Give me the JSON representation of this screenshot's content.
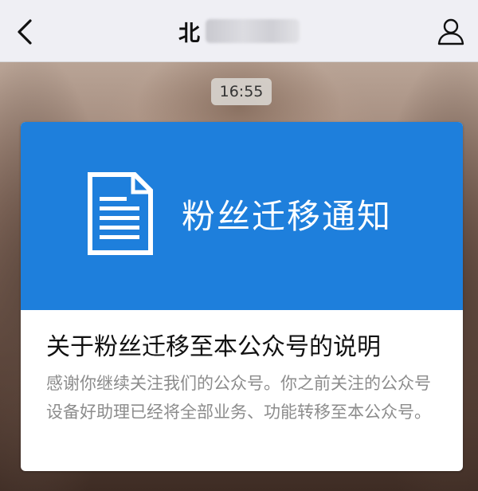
{
  "navbar": {
    "title": "北",
    "back_icon": "chevron-left-icon",
    "profile_icon": "person-icon"
  },
  "chat": {
    "timestamp": "16:55"
  },
  "article_card": {
    "cover_title": "粉丝迁移通知",
    "cover_icon": "document-icon",
    "cover_color": "#1e7fdc",
    "title": "关于粉丝迁移至本公众号的说明",
    "description": "感谢你继续关注我们的公众号。你之前关注的公众号设备好助理已经将全部业务、功能转移至本公众号。"
  }
}
